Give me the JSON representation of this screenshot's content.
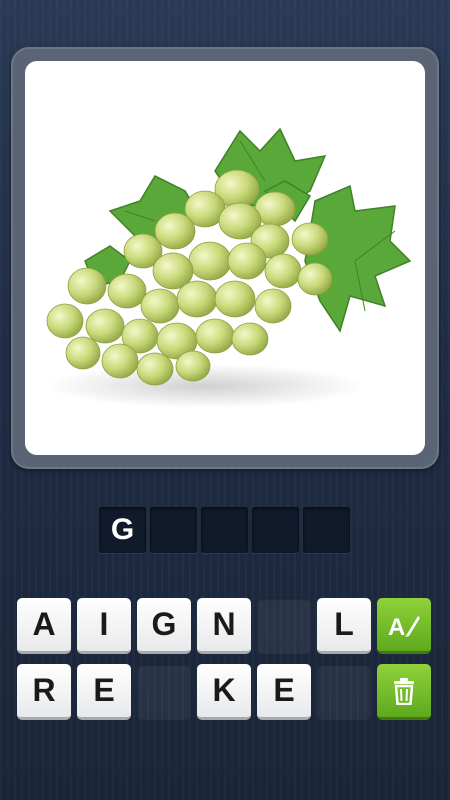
{
  "picture": {
    "subject": "green grapes"
  },
  "answer": {
    "slots": [
      "G",
      "",
      "",
      "",
      ""
    ]
  },
  "keyboard": {
    "row1": [
      "A",
      "I",
      "G",
      "N",
      "",
      "L"
    ],
    "row2": [
      "R",
      "E",
      "",
      "K",
      "E",
      ""
    ]
  },
  "actions": {
    "hint_icon": "reveal-letter-icon",
    "remove_icon": "trash-icon"
  },
  "colors": {
    "action_green": "#6cbb26",
    "background": "#24324b"
  }
}
